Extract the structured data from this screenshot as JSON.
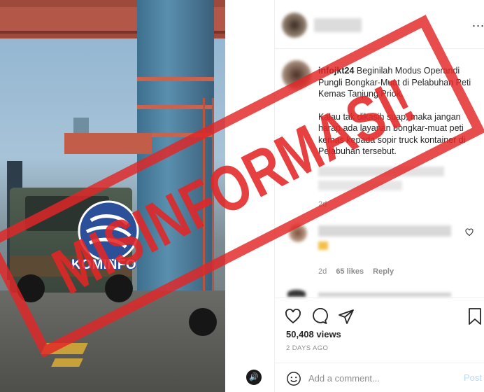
{
  "post": {
    "username": "infojkt24",
    "caption_line1": "Beginilah Modus Operandi Pungli Bongkar-Muat di Pelabuhan Peti Kemas Tanjung Priok.",
    "caption_line2": "Kalau tak dikasih suap, maka jangan harap ada layanan bongkar-muat peti kemas kepada sopir truck kontainer di Pelabuhan tersebut.",
    "caption_time": "2d",
    "more_label": "...",
    "views": "50,408 views",
    "posted_ago": "2 DAYS AGO"
  },
  "comment": {
    "time": "2d",
    "likes": "65 likes",
    "reply_label": "Reply"
  },
  "composer": {
    "placeholder": "Add a comment...",
    "post_label": "Post"
  },
  "overlay": {
    "stamp_text": "MISINFORMASI!",
    "logo_text": "KOMINFO",
    "stamp_color": "#e22626",
    "logo_color": "#2c4f9a"
  },
  "icons": [
    "heart-icon",
    "comment-icon",
    "share-icon",
    "bookmark-icon",
    "emoji-icon",
    "sound-icon",
    "more-options-icon"
  ]
}
